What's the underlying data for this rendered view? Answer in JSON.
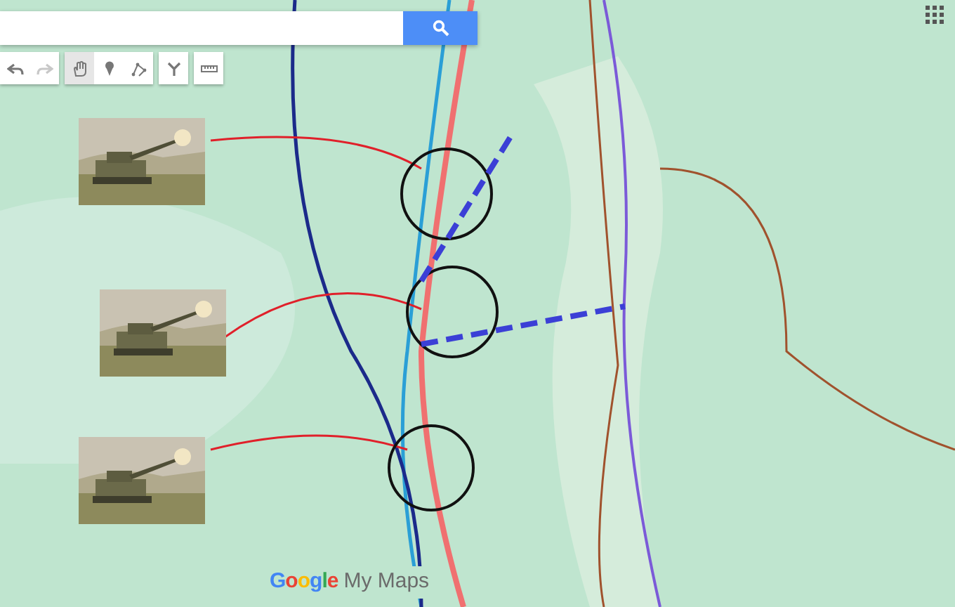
{
  "toolbar": [
    {
      "kind": "undo",
      "disabled": false
    },
    {
      "kind": "redo",
      "disabled": true
    },
    {
      "kind": "hand",
      "selected": true
    },
    {
      "kind": "marker",
      "selected": false
    },
    {
      "kind": "line",
      "selected": false
    },
    {
      "kind": "directions",
      "selected": false
    },
    {
      "kind": "ruler",
      "selected": false
    }
  ],
  "logo": {
    "brand": "Google",
    "product": "My Maps"
  }
}
